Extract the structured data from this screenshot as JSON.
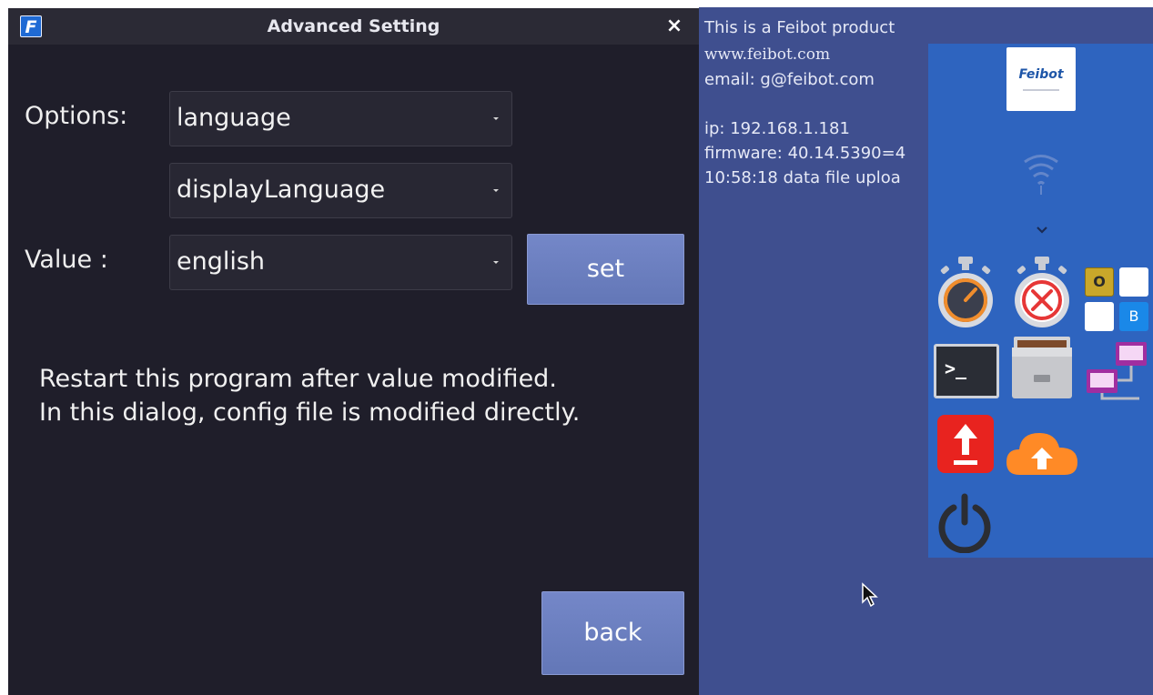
{
  "dialog": {
    "title": "Advanced Setting",
    "app_icon_letter": "F",
    "close_glyph": "×",
    "options_label": "Options:",
    "value_label": "Value :",
    "option_primary": "language",
    "option_secondary": "displayLanguage",
    "value_selected": "english",
    "set_label": "set",
    "back_label": "back",
    "message_lines": [
      "Restart this program after value modified.",
      "In this dialog, config file is modified directly."
    ]
  },
  "desktop": {
    "info_lines": [
      "This is a Feibot product",
      "www.feibot.com",
      "email: g@feibot.com",
      "ip: 192.168.1.181",
      "firmware: 40.14.5390=4",
      "10:58:18 data file uploa"
    ],
    "logo_text": "Feibot",
    "colors": {
      "desktop_bg": "#3f4f8f",
      "panel_bg": "#2e64bf",
      "dialog_bg": "#1f1e2a",
      "button_bg": "#6e81c1"
    },
    "launcher_icons": [
      "wifi-icon",
      "chevron-down-icon",
      "stopwatch-icon",
      "stopwatch-cancel-icon",
      "ob-grid-icon",
      "terminal-icon",
      "file-cabinet-icon",
      "network-computers-icon",
      "upload-icon",
      "cloud-upload-icon",
      "power-icon"
    ],
    "ob_grid_letters": [
      "O",
      "B"
    ],
    "terminal_prompt": ">_"
  }
}
